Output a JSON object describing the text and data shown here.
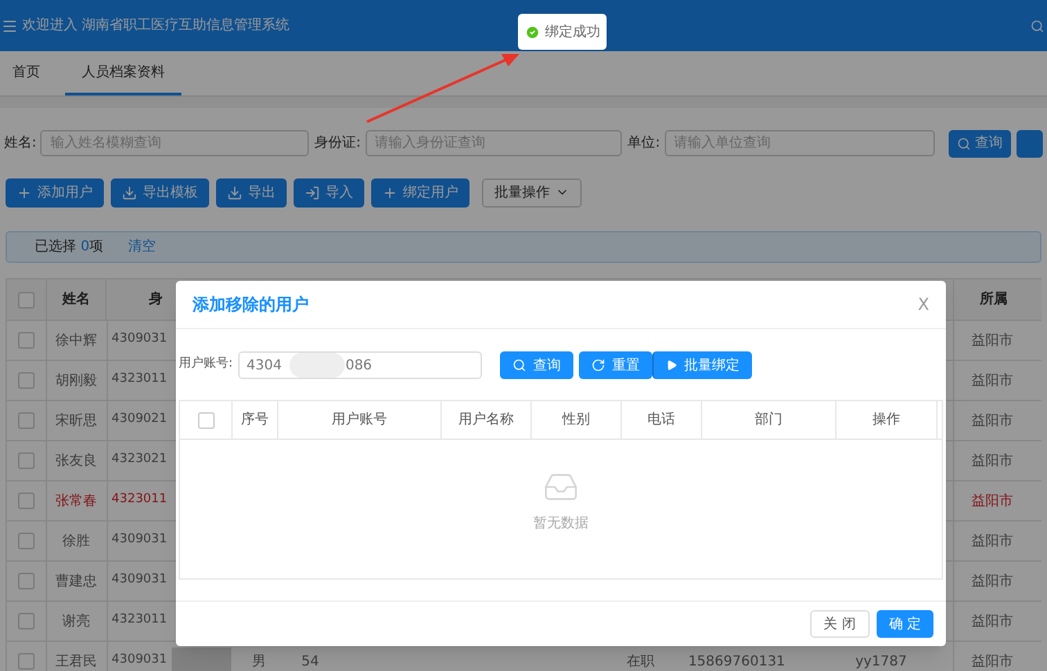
{
  "header": {
    "title": "欢迎进入 湖南省职工医疗互助信息管理系统"
  },
  "tabs": [
    {
      "label": "首页",
      "selected": false
    },
    {
      "label": "人员档案资料",
      "selected": true
    }
  ],
  "filters": [
    {
      "label": "姓名:",
      "placeholder": "输入姓名模糊查询"
    },
    {
      "label": "身份证:",
      "placeholder": "请输入身份证查询"
    },
    {
      "label": "单位:",
      "placeholder": "请输入单位查询"
    }
  ],
  "search_button": "查询",
  "toolbar": [
    {
      "kind": "add",
      "label": "添加用户"
    },
    {
      "kind": "download",
      "label": "导出模板"
    },
    {
      "kind": "download",
      "label": "导出"
    },
    {
      "kind": "import",
      "label": "导入"
    },
    {
      "kind": "add",
      "label": "绑定用户"
    },
    {
      "kind": "dropdown",
      "label": "批量操作"
    }
  ],
  "selection": {
    "text_before": "已选择 ",
    "count": "0",
    "text_after": "项",
    "clear": "清空"
  },
  "table": {
    "header_checked": false,
    "columns": [
      "姓名",
      "身",
      "所属"
    ],
    "rows": [
      {
        "checked": false,
        "flagged": false,
        "name": "徐中辉",
        "id": "4309031",
        "dept": "益阳市"
      },
      {
        "checked": false,
        "flagged": false,
        "name": "胡刚毅",
        "id": "4323011",
        "dept": "益阳市"
      },
      {
        "checked": false,
        "flagged": false,
        "name": "宋昕思",
        "id": "4309021",
        "dept": "益阳市"
      },
      {
        "checked": false,
        "flagged": false,
        "name": "张友良",
        "id": "4323021",
        "dept": "益阳市"
      },
      {
        "checked": false,
        "flagged": true,
        "name": "张常春",
        "id": "4323011",
        "dept": "益阳市"
      },
      {
        "checked": false,
        "flagged": false,
        "name": "徐胜",
        "id": "4309031",
        "dept": "益阳市"
      },
      {
        "checked": false,
        "flagged": false,
        "name": "曹建忠",
        "id": "4309031",
        "dept": "益阳市"
      },
      {
        "checked": false,
        "flagged": false,
        "name": "谢亮",
        "id": "4323011",
        "dept": "益阳市"
      },
      {
        "checked": false,
        "flagged": false,
        "name": "王君民",
        "id": "4309031",
        "gender": "男",
        "age": "54",
        "status": "在职",
        "phone": "15869760131",
        "account": "yy1787",
        "dept": "益阳市"
      }
    ]
  },
  "dialog": {
    "title": "添加移除的用户",
    "close": "X",
    "field_label": "用户账号:",
    "value_start": "4304",
    "value_end": "086",
    "buttons": [
      {
        "kind": "search",
        "label": "查询"
      },
      {
        "kind": "reset",
        "label": "重置"
      },
      {
        "kind": "bind",
        "label": "批量绑定"
      }
    ],
    "header_checked": false,
    "columns": [
      "序号",
      "用户账号",
      "用户名称",
      "性别",
      "电话",
      "部门",
      "操作"
    ],
    "empty_text": "暂无数据",
    "footer_buttons": [
      {
        "kind": "secondary",
        "label": "关 闭"
      },
      {
        "kind": "primary",
        "label": "确 定"
      }
    ]
  },
  "toast": {
    "text": "绑定成功"
  }
}
